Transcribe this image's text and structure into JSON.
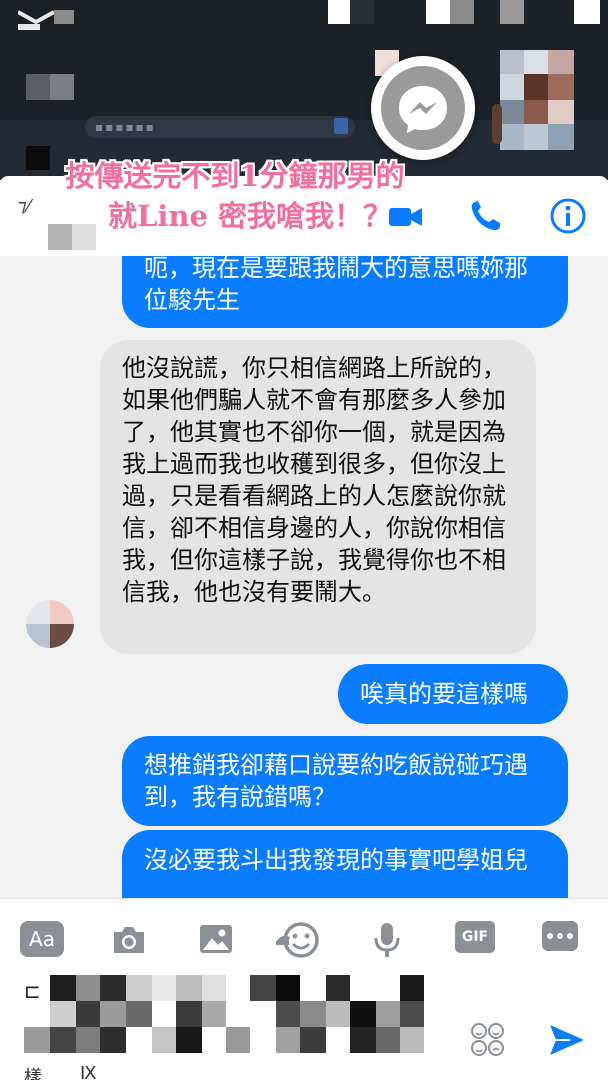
{
  "overlay_caption": {
    "line1": "按傳送完不到1分鐘那男的",
    "line2": "就Line 密我嗆我！？"
  },
  "header": {
    "video_call": "video-call-icon",
    "voice_call": "phone-icon",
    "info": "info-icon",
    "accent": "#0a7cff"
  },
  "messages": [
    {
      "from": "me",
      "text": "呃，現在是要跟我鬧大的意思嗎妳那位駿先生"
    },
    {
      "from": "them",
      "text": "他沒說謊，你只相信網路上所說的，如果他們騙人就不會有那麼多人參加了，他其實也不卻你一個，就是因為我上過而我也收穫到很多，但你沒上過，只是看看網路上的人怎麼說你就信，卻不相信身邊的人，你說你相信我，但你這樣子說，我覺得你也不相信我，他也沒有要鬧大。"
    },
    {
      "from": "me",
      "text": "唉真的要這樣嗎"
    },
    {
      "from": "me",
      "text": "想推銷我卻藉口說要約吃飯說碰巧遇到，我有說錯嗎？"
    },
    {
      "from": "me",
      "text": "沒必要我斗出我發現的事實吧學姐兒"
    }
  ],
  "composer": {
    "aa_label": "Aa",
    "gif_label": "GIF",
    "icons": [
      "camera-icon",
      "image-icon",
      "sticker-icon",
      "microphone-icon",
      "gif-icon",
      "more-icon",
      "emoji-icon",
      "send-icon"
    ]
  },
  "colors": {
    "outgoing_bubble": "#0a7cff",
    "incoming_bubble": "#e4e4e4",
    "caption_pink": "#f06fa0"
  }
}
